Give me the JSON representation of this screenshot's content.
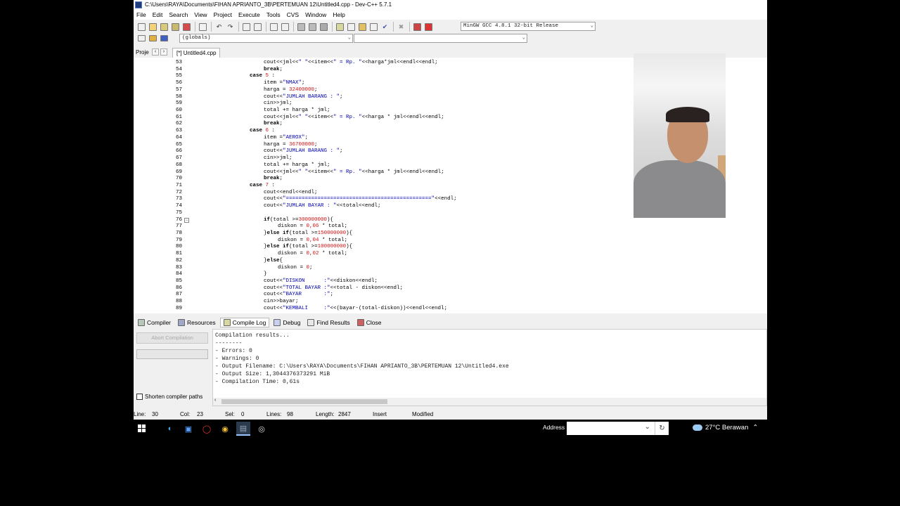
{
  "window": {
    "title": "C:\\Users\\RAYA\\Documents\\FIHAN APRIANTO_3B\\PERTEMUAN 12\\Untitled4.cpp - Dev-C++ 5.7.1"
  },
  "menu": [
    "File",
    "Edit",
    "Search",
    "View",
    "Project",
    "Execute",
    "Tools",
    "CVS",
    "Window",
    "Help"
  ],
  "toolbar": {
    "compiler_select": "MinGW GCC 4.8.1 32-bit Release",
    "scope_select": "(globals)",
    "member_select": ""
  },
  "tabs": {
    "project_label": "Proje",
    "file_tab": "[*] Untitled4.cpp"
  },
  "editor": {
    "lines": [
      {
        "n": "53",
        "code": "cout<<jml<<\" \"<<item<<\" = Rp. \"<<harga*jml<<endl<<endl;",
        "indent": 2
      },
      {
        "n": "54",
        "code": "break;",
        "indent": 2
      },
      {
        "n": "55",
        "code": "case 5 :",
        "indent": 1
      },
      {
        "n": "56",
        "code": "item =\"NMAX\";",
        "indent": 2
      },
      {
        "n": "57",
        "code": "harga = 32400000;",
        "indent": 2
      },
      {
        "n": "58",
        "code": "cout<<\"JUMLAH BARANG : \";",
        "indent": 2
      },
      {
        "n": "59",
        "code": "cin>>jml;",
        "indent": 2
      },
      {
        "n": "60",
        "code": "total += harga * jml;",
        "indent": 2
      },
      {
        "n": "61",
        "code": "cout<<jml<<\" \"<<item<<\" = Rp. \"<<harga * jml<<endl<<endl;",
        "indent": 2
      },
      {
        "n": "62",
        "code": "break;",
        "indent": 2
      },
      {
        "n": "63",
        "code": "case 6 :",
        "indent": 1
      },
      {
        "n": "64",
        "code": "item =\"AEROX\";",
        "indent": 2
      },
      {
        "n": "65",
        "code": "harga = 36700000;",
        "indent": 2
      },
      {
        "n": "66",
        "code": "cout<<\"JUMLAH BARANG : \";",
        "indent": 2
      },
      {
        "n": "67",
        "code": "cin>>jml;",
        "indent": 2
      },
      {
        "n": "68",
        "code": "total += harga * jml;",
        "indent": 2
      },
      {
        "n": "69",
        "code": "cout<<jml<<\" \"<<item<<\" = Rp. \"<<harga * jml<<endl<<endl;",
        "indent": 2
      },
      {
        "n": "70",
        "code": "break;",
        "indent": 2
      },
      {
        "n": "71",
        "code": "case 7 :",
        "indent": 1
      },
      {
        "n": "72",
        "code": "cout<<endl<<endl;",
        "indent": 2
      },
      {
        "n": "73",
        "code": "cout<<\"==============================================\"<<endl;",
        "indent": 2
      },
      {
        "n": "74",
        "code": "cout<<\"JUMLAH BAYAR : \"<<total<<endl;",
        "indent": 2
      },
      {
        "n": "75",
        "code": "",
        "indent": 2
      },
      {
        "n": "76",
        "code": "if(total >=300000000){",
        "indent": 2
      },
      {
        "n": "77",
        "code": "diskon = 0,06 * total;",
        "indent": 3
      },
      {
        "n": "78",
        "code": "}else if(total >=150000000){",
        "indent": 2
      },
      {
        "n": "79",
        "code": "diskon = 0,04 * total;",
        "indent": 3
      },
      {
        "n": "80",
        "code": "}else if(total >=100000000){",
        "indent": 2
      },
      {
        "n": "81",
        "code": "diskon = 0,02 * total;",
        "indent": 3
      },
      {
        "n": "82",
        "code": "}else{",
        "indent": 2
      },
      {
        "n": "83",
        "code": "diskon = 0;",
        "indent": 3
      },
      {
        "n": "84",
        "code": "}",
        "indent": 2
      },
      {
        "n": "85",
        "code": "cout<<\"DISKON      :\"<<diskon<<endl;",
        "indent": 2
      },
      {
        "n": "86",
        "code": "cout<<\"TOTAL BAYAR :\"<<total - diskon<<endl;",
        "indent": 2
      },
      {
        "n": "87",
        "code": "cout<<\"BAYAR       :\";",
        "indent": 2
      },
      {
        "n": "88",
        "code": "cin>>bayar;",
        "indent": 2
      },
      {
        "n": "89",
        "code": "cout<<\"KEMBALI     :\"<<(bayar-(total-diskon))<<endl<<endl;",
        "indent": 2
      }
    ]
  },
  "bottom_tabs": [
    "Compiler",
    "Resources",
    "Compile Log",
    "Debug",
    "Find Results",
    "Close"
  ],
  "bottom_panel": {
    "abort_label": "Abort Compilation",
    "shorten_label": "Shorten compiler paths",
    "log_lines": [
      "Compilation results...",
      "--------",
      "- Errors: 0",
      "- Warnings: 0",
      "- Output Filename: C:\\Users\\RAYA\\Documents\\FIHAN APRIANTO_3B\\PERTEMUAN 12\\Untitled4.exe",
      "- Output Size: 1,3044376373291 MiB",
      "- Compilation Time: 0,61s"
    ]
  },
  "status": {
    "line": "Line:",
    "line_val": "30",
    "col": "Col:",
    "col_val": "23",
    "sel": "Sel:",
    "sel_val": "0",
    "lines": "Lines:",
    "lines_val": "98",
    "length": "Length:",
    "length_val": "2847",
    "mode": "Insert",
    "modified": "Modified"
  },
  "taskbar": {
    "address_label": "Address",
    "weather": "27°C  Berawan"
  }
}
